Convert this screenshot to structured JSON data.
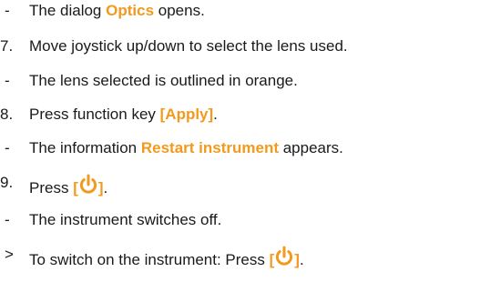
{
  "lines": [
    {
      "marker": "-",
      "parts": [
        "The dialog ",
        "Optics",
        " opens."
      ]
    },
    {
      "marker": "7.",
      "text": "Move joystick up/down to select the lens used."
    },
    {
      "marker": "-",
      "text": "The lens selected is outlined in orange."
    },
    {
      "marker": "8.",
      "parts": [
        "Press function key ",
        "[Apply]",
        "."
      ]
    },
    {
      "marker": "-",
      "parts": [
        "The information ",
        "Restart instrument",
        " appears."
      ]
    },
    {
      "marker": "9.",
      "parts": [
        "Press ",
        "[",
        "]",
        "."
      ]
    },
    {
      "marker": "-",
      "text": "The instrument switches off."
    },
    {
      "marker": ">",
      "parts": [
        "To switch on the instrument: Press ",
        "[",
        "]",
        "."
      ]
    }
  ],
  "icons": {
    "power": "power-icon"
  },
  "colors": {
    "highlight": "#f29a1d",
    "text": "#1a1a1a"
  }
}
